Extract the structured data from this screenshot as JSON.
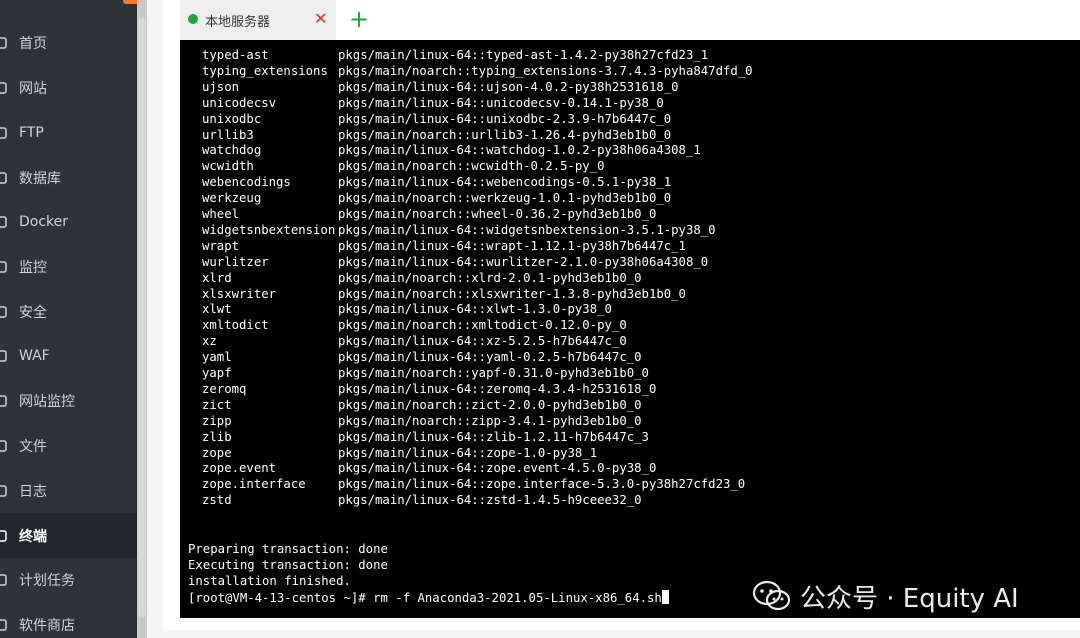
{
  "sidebar": {
    "items": [
      {
        "label": "首页",
        "icon": "home-icon"
      },
      {
        "label": "网站",
        "icon": "globe-icon"
      },
      {
        "label": "FTP",
        "icon": "ftp-icon"
      },
      {
        "label": "数据库",
        "icon": "database-icon"
      },
      {
        "label": "Docker",
        "icon": "docker-icon"
      },
      {
        "label": "监控",
        "icon": "monitor-icon"
      },
      {
        "label": "安全",
        "icon": "shield-icon"
      },
      {
        "label": "WAF",
        "icon": "firewall-icon"
      },
      {
        "label": "网站监控",
        "icon": "site-monitor-icon"
      },
      {
        "label": "文件",
        "icon": "folder-icon"
      },
      {
        "label": "日志",
        "icon": "log-icon"
      },
      {
        "label": "终端",
        "icon": "terminal-icon",
        "active": true
      },
      {
        "label": "计划任务",
        "icon": "clock-icon"
      },
      {
        "label": "软件商店",
        "icon": "store-icon"
      }
    ]
  },
  "tabs": [
    {
      "label": "本地服务器",
      "status_color": "#20a53a"
    }
  ],
  "add_tab": "+",
  "terminal": {
    "packages": [
      {
        "name": "typed-ast",
        "channel": "pkgs/main/linux-64::typed-ast-1.4.2-py38h27cfd23_1"
      },
      {
        "name": "typing_extensions",
        "channel": "pkgs/main/noarch::typing_extensions-3.7.4.3-pyha847dfd_0"
      },
      {
        "name": "ujson",
        "channel": "pkgs/main/linux-64::ujson-4.0.2-py38h2531618_0"
      },
      {
        "name": "unicodecsv",
        "channel": "pkgs/main/linux-64::unicodecsv-0.14.1-py38_0"
      },
      {
        "name": "unixodbc",
        "channel": "pkgs/main/linux-64::unixodbc-2.3.9-h7b6447c_0"
      },
      {
        "name": "urllib3",
        "channel": "pkgs/main/noarch::urllib3-1.26.4-pyhd3eb1b0_0"
      },
      {
        "name": "watchdog",
        "channel": "pkgs/main/linux-64::watchdog-1.0.2-py38h06a4308_1"
      },
      {
        "name": "wcwidth",
        "channel": "pkgs/main/noarch::wcwidth-0.2.5-py_0"
      },
      {
        "name": "webencodings",
        "channel": "pkgs/main/linux-64::webencodings-0.5.1-py38_1"
      },
      {
        "name": "werkzeug",
        "channel": "pkgs/main/noarch::werkzeug-1.0.1-pyhd3eb1b0_0"
      },
      {
        "name": "wheel",
        "channel": "pkgs/main/noarch::wheel-0.36.2-pyhd3eb1b0_0"
      },
      {
        "name": "widgetsnbextension",
        "channel": "pkgs/main/linux-64::widgetsnbextension-3.5.1-py38_0"
      },
      {
        "name": "wrapt",
        "channel": "pkgs/main/linux-64::wrapt-1.12.1-py38h7b6447c_1"
      },
      {
        "name": "wurlitzer",
        "channel": "pkgs/main/linux-64::wurlitzer-2.1.0-py38h06a4308_0"
      },
      {
        "name": "xlrd",
        "channel": "pkgs/main/noarch::xlrd-2.0.1-pyhd3eb1b0_0"
      },
      {
        "name": "xlsxwriter",
        "channel": "pkgs/main/noarch::xlsxwriter-1.3.8-pyhd3eb1b0_0"
      },
      {
        "name": "xlwt",
        "channel": "pkgs/main/linux-64::xlwt-1.3.0-py38_0"
      },
      {
        "name": "xmltodict",
        "channel": "pkgs/main/noarch::xmltodict-0.12.0-py_0"
      },
      {
        "name": "xz",
        "channel": "pkgs/main/linux-64::xz-5.2.5-h7b6447c_0"
      },
      {
        "name": "yaml",
        "channel": "pkgs/main/linux-64::yaml-0.2.5-h7b6447c_0"
      },
      {
        "name": "yapf",
        "channel": "pkgs/main/noarch::yapf-0.31.0-pyhd3eb1b0_0"
      },
      {
        "name": "zeromq",
        "channel": "pkgs/main/linux-64::zeromq-4.3.4-h2531618_0"
      },
      {
        "name": "zict",
        "channel": "pkgs/main/noarch::zict-2.0.0-pyhd3eb1b0_0"
      },
      {
        "name": "zipp",
        "channel": "pkgs/main/noarch::zipp-3.4.1-pyhd3eb1b0_0"
      },
      {
        "name": "zlib",
        "channel": "pkgs/main/linux-64::zlib-1.2.11-h7b6447c_3"
      },
      {
        "name": "zope",
        "channel": "pkgs/main/linux-64::zope-1.0-py38_1"
      },
      {
        "name": "zope.event",
        "channel": "pkgs/main/linux-64::zope.event-4.5.0-py38_0"
      },
      {
        "name": "zope.interface",
        "channel": "pkgs/main/linux-64::zope.interface-5.3.0-py38h27cfd23_0"
      },
      {
        "name": "zstd",
        "channel": "pkgs/main/linux-64::zstd-1.4.5-h9ceee32_0"
      }
    ],
    "log": [
      "Preparing transaction: done",
      "Executing transaction: done",
      "installation finished."
    ],
    "prompt_line": "[root@VM-4-13-centos ~]# rm -f Anaconda3-2021.05-Linux-x86_64.sh"
  },
  "watermark": {
    "text": "公众号 · Equity AI",
    "icon": "wechat-icon"
  }
}
